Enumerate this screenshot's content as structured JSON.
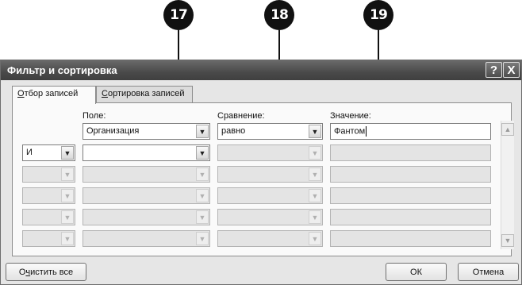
{
  "callouts": [
    "17",
    "18",
    "19"
  ],
  "dialog": {
    "title": "Фильтр и сортировка",
    "help_label": "?",
    "close_label": "X"
  },
  "tabs": [
    {
      "prefix": "",
      "accel": "О",
      "rest": "тбор записей",
      "active": true
    },
    {
      "prefix": "",
      "accel": "С",
      "rest": "ортировка записей",
      "active": false
    }
  ],
  "headers": {
    "field": "Поле:",
    "comparison": "Сравнение:",
    "value": "Значение:"
  },
  "first_row": {
    "field": "Организация",
    "comparison": "равно",
    "value": "Фантом"
  },
  "second_row": {
    "connector": "И"
  },
  "icons": {
    "dropdown": "chevron-down-icon",
    "scroll_up": "scroll-up-icon",
    "scroll_down": "scroll-down-icon"
  },
  "buttons": {
    "clear_prefix": "О",
    "clear_accel": "ч",
    "clear_rest": "истить все",
    "ok": "ОК",
    "cancel": "Отмена"
  }
}
